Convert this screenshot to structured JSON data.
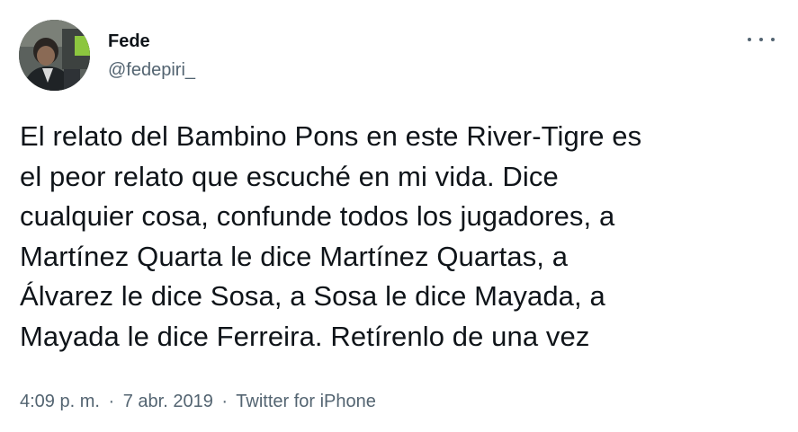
{
  "author": {
    "display_name": "Fede",
    "handle": "@fedepiri_"
  },
  "tweet": {
    "lines": [
      "El relato del Bambino Pons en este River-Tigre es",
      "el peor relato que escuché en mi vida. Dice",
      "cualquier cosa, confunde todos los jugadores, a",
      "Martínez Quarta le dice Martínez Quartas, a",
      "Álvarez le dice Sosa, a Sosa le dice Mayada, a",
      "Mayada le dice Ferreira. Retírenlo de una vez"
    ]
  },
  "meta": {
    "time": "4:09 p. m.",
    "separator": "·",
    "date": "7 abr. 2019",
    "source": "Twitter for iPhone"
  },
  "icons": {
    "more": "more-dots-icon",
    "avatar": "profile-photo"
  },
  "colors": {
    "text_primary": "#0f1419",
    "text_secondary": "#536471",
    "background": "#ffffff"
  }
}
